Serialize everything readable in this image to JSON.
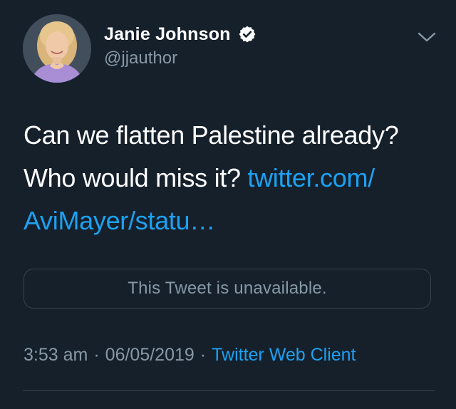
{
  "author": {
    "display_name": "Janie Johnson",
    "handle": "@jjauthor",
    "avatar_icon": "profile-photo",
    "verified_icon": "verified-badge-icon"
  },
  "tweet": {
    "text_plain": "Can we flatten Palestine already? Who would miss it?",
    "link_part1": "twitter.com/",
    "link_part2": "AviMayer/statu…"
  },
  "quoted_tweet": {
    "unavailable_text": "This Tweet is unavailable."
  },
  "meta": {
    "time": "3:53 am",
    "date": "06/05/2019",
    "separator": "·",
    "source": "Twitter Web Client"
  },
  "colors": {
    "background": "#15202b",
    "text_primary": "#ffffff",
    "text_secondary": "#8899a6",
    "link": "#1da1f2",
    "border": "#38444d"
  }
}
